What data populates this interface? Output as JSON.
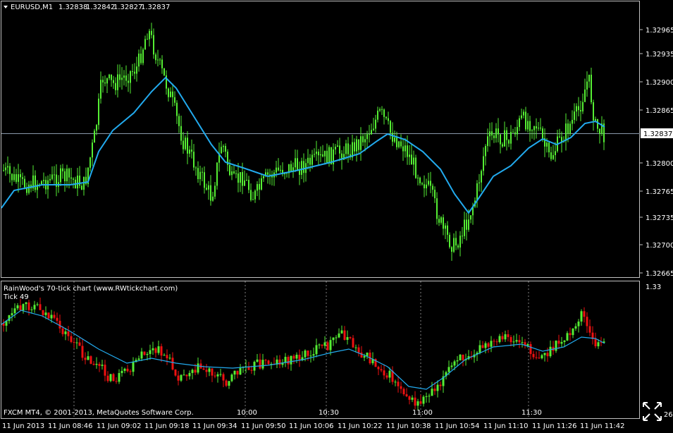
{
  "main": {
    "symbol_label": "EURUSD,M1",
    "ohlc": [
      "1.32838",
      "1.32842",
      "1.32827",
      "1.32837"
    ],
    "current_price": "1.32837",
    "price_ticks": [
      "1.32965",
      "1.32935",
      "1.32900",
      "1.32865",
      "1.32800",
      "1.32765",
      "1.32735",
      "1.32700",
      "1.32665"
    ]
  },
  "sub": {
    "title": "RainWood's 70-tick chart  (www.RWtickchart.com)",
    "indicator": "Tick 49",
    "top_value": "1.33",
    "bottom_value": "1.326",
    "session_labels": [
      "10:00",
      "10:30",
      "11:00",
      "11:30"
    ],
    "copyright": "FXCM MT4, © 2001-2013, MetaQuotes Software Corp."
  },
  "time_axis": [
    "11 Jun 2013",
    "11 Jun 08:46",
    "11 Jun 09:02",
    "11 Jun 09:18",
    "11 Jun 09:34",
    "11 Jun 09:50",
    "11 Jun 10:06",
    "11 Jun 10:22",
    "11 Jun 10:38",
    "11 Jun 10:54",
    "11 Jun 11:10",
    "11 Jun 11:26",
    "11 Jun 11:42"
  ],
  "colors": {
    "bull": "#55ee33",
    "bear": "#ee1111",
    "ma": "#22aaee",
    "grid": "#808080",
    "border": "#c0c0c0"
  },
  "icons": {
    "menu": "triangle-down-icon",
    "resize": "expand-arrows-icon"
  }
}
